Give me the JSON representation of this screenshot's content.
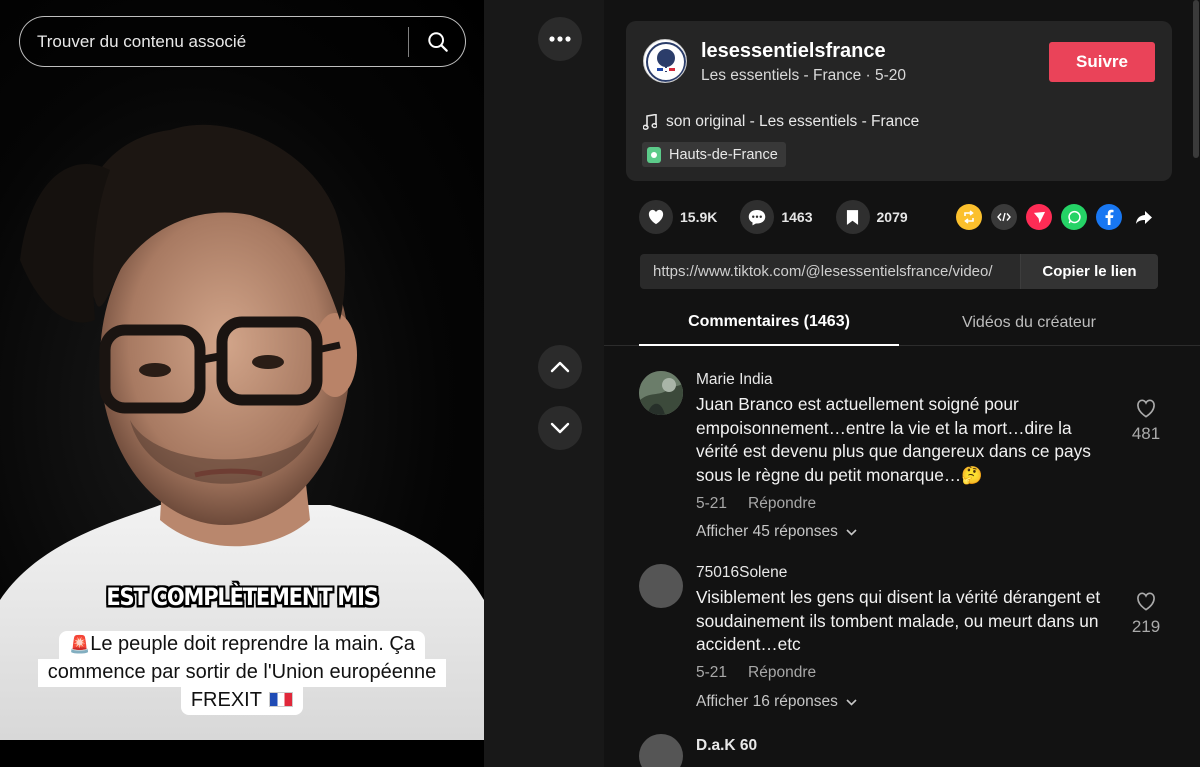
{
  "search": {
    "placeholder": "Trouver du contenu associé"
  },
  "video": {
    "caption_top": "EST COMPLÈTEMENT MIS",
    "caption_line1": "Le peuple doit reprendre la main. Ça",
    "caption_line2": "commence par sortir de l'Union européenne",
    "caption_line3": "FREXIT",
    "siren_icon": "🚨",
    "flag_icon": "french-flag"
  },
  "author": {
    "username": "lesessentielsfrance",
    "subtitle": "Les essentiels - France · 5-20",
    "follow_label": "Suivre",
    "music": "son original - Les essentiels - France",
    "location": "Hauts-de-France"
  },
  "stats": {
    "likes": "15.9K",
    "comments": "1463",
    "saves": "2079"
  },
  "share_icons": [
    "repost-icon",
    "embed-icon",
    "send-icon",
    "whatsapp-icon",
    "facebook-icon",
    "share-arrow-icon"
  ],
  "link": {
    "url": "https://www.tiktok.com/@lesessentielsfrance/video/",
    "copy_label": "Copier le lien"
  },
  "tabs": [
    {
      "label": "Commentaires (1463)",
      "active": true
    },
    {
      "label": "Vidéos du créateur",
      "active": false
    }
  ],
  "comments": [
    {
      "user": "Marie India",
      "text": "Juan Branco est actuellement soigné pour empoisonnement…entre la vie et la mort…dire la vérité est devenu plus que dangereux dans ce pays sous le règne du petit monarque…🤔",
      "date": "5-21",
      "reply_label": "Répondre",
      "likes": "481",
      "replies_label": "Afficher 45 réponses"
    },
    {
      "user": "75016Solene",
      "text": "Visiblement les gens qui disent la vérité dérangent et soudainement ils tombent malade, ou meurt dans un accident…etc",
      "date": "5-21",
      "reply_label": "Répondre",
      "likes": "219",
      "replies_label": "Afficher 16 réponses"
    },
    {
      "user": "D.a.K 60"
    }
  ],
  "colors": {
    "follow": "#ea4359",
    "background": "#121212",
    "card": "#252525"
  }
}
